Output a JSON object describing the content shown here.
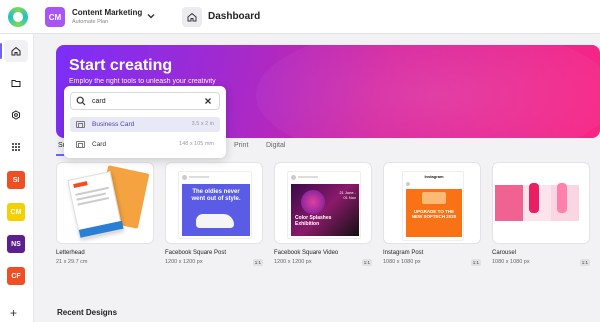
{
  "workspace": {
    "initials": "CM",
    "name": "Content Marketing",
    "plan": "Automate Plan",
    "color": "#a855f7"
  },
  "header": {
    "title": "Dashboard"
  },
  "sidebar": {
    "nav_icons": [
      "home-icon",
      "folder-icon",
      "settings-gear-icon",
      "grid-apps-icon"
    ],
    "workspaces": [
      {
        "initials": "SI",
        "color": "#f04e23"
      },
      {
        "initials": "CM",
        "color": "#f5d000"
      },
      {
        "initials": "NS",
        "color": "#5b1f8f"
      },
      {
        "initials": "CF",
        "color": "#f04e23"
      }
    ],
    "add_label": "+"
  },
  "hero": {
    "title": "Start creating",
    "subtitle": "Employ the right tools to unleash your creativity"
  },
  "search": {
    "value": "card",
    "suggestions": [
      {
        "label": "Business Card",
        "dims": "3.5 x 2 in"
      },
      {
        "label": "Card",
        "dims": "148 x 105 mm"
      }
    ]
  },
  "tabs": [
    "Su",
    "Print",
    "Digital"
  ],
  "templates": [
    {
      "name": "Letterhead",
      "dims": "21 x 29.7 cm",
      "badge": ""
    },
    {
      "name": "Facebook Square Post",
      "dims": "1200 x 1200 px",
      "badge": "1:1",
      "thumb_text": "The oldies never went out of style."
    },
    {
      "name": "Facebook Square Video",
      "dims": "1200 x 1200 px",
      "badge": "1:1",
      "thumb_text": "Color Splashes Exhibition",
      "thumb_date": "21 June - 01 Nov"
    },
    {
      "name": "Instagram Post",
      "dims": "1080 x 1080 px",
      "badge": "1:1",
      "thumb_header": "Instagram",
      "thumb_text": "UPGRADE TO THE NEW SOFTECH 2020"
    },
    {
      "name": "Carousel",
      "dims": "1080 x 1080 px",
      "badge": "1:1"
    }
  ],
  "recent": {
    "title": "Recent Designs"
  }
}
